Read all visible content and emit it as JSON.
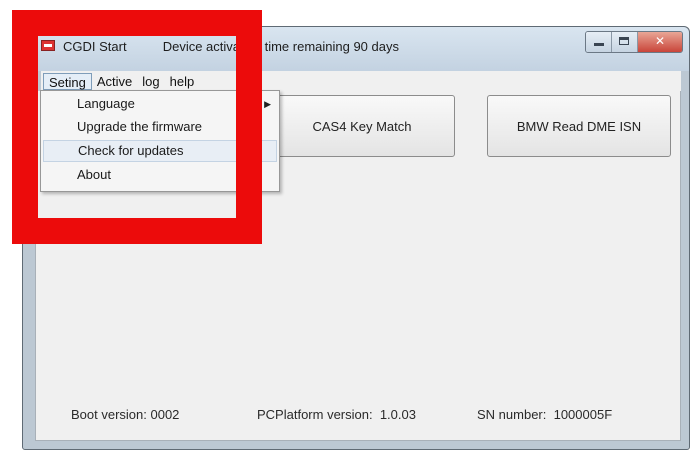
{
  "window": {
    "title": "CGDI Start",
    "status_title": "Device activation time remaining 90 days"
  },
  "menubar": {
    "items": [
      {
        "label": "Seting"
      },
      {
        "label": "Active"
      },
      {
        "label": "log"
      },
      {
        "label": "help"
      }
    ]
  },
  "dropdown": {
    "items": [
      {
        "label": "Language",
        "has_submenu": true
      },
      {
        "label": "Upgrade the firmware"
      },
      {
        "label": "Check for updates"
      },
      {
        "label": "About"
      }
    ]
  },
  "buttons": {
    "cas4": "CAS4 Key Match",
    "bmw": "BMW Read DME ISN"
  },
  "status": {
    "boot": "Boot version: 0002",
    "pcplatform": "PCPlatform version:  1.0.03",
    "sn": "SN number:  1000005F"
  },
  "colors": {
    "highlight": "#ec0b0b"
  },
  "icons": {
    "app": "app-icon",
    "submenu": "submenu-arrow-icon"
  }
}
